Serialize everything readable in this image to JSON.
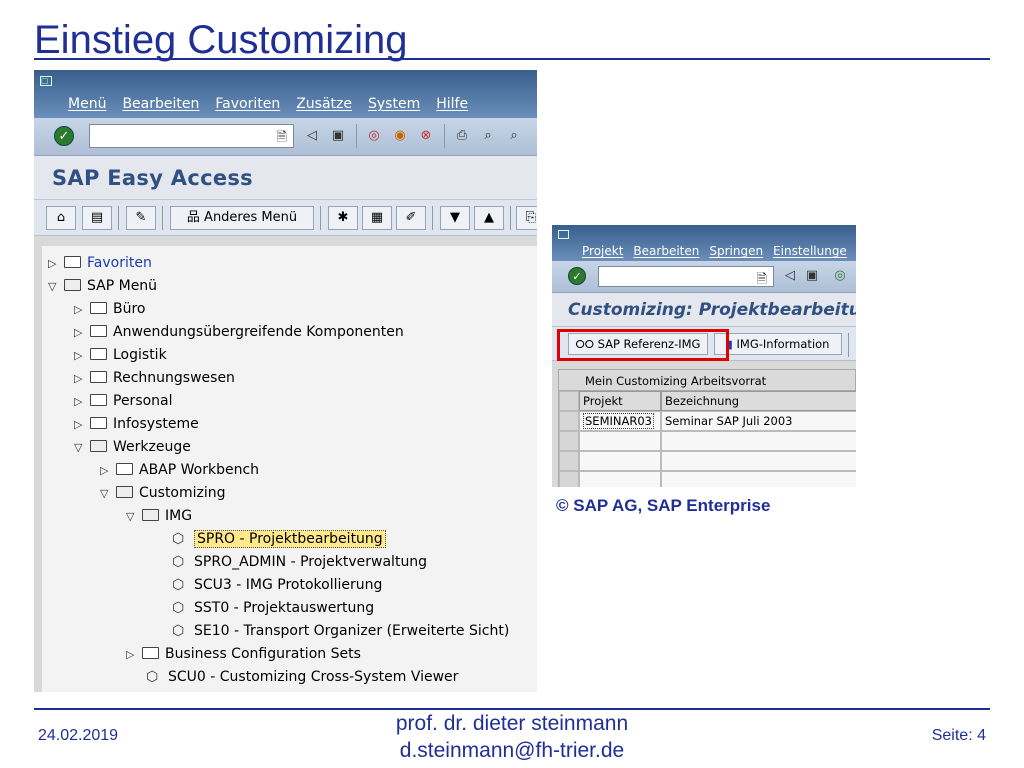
{
  "slide": {
    "title": "Einstieg Customizing",
    "copyright": "© SAP AG, SAP Enterprise",
    "footer": {
      "date": "24.02.2019",
      "author": "prof. dr. dieter steinmann",
      "email": "d.steinmann@fh-trier.de",
      "page": "Seite: 4"
    }
  },
  "window1": {
    "menu": [
      "Menü",
      "Bearbeiten",
      "Favoriten",
      "Zusätze",
      "System",
      "Hilfe"
    ],
    "title": "SAP Easy Access",
    "toolbar": {
      "other_menu": "Anderes Menü"
    },
    "tree": [
      {
        "label": "Favoriten",
        "kind": "folder",
        "open": false,
        "level": 0,
        "blue": true
      },
      {
        "label": "SAP Menü",
        "kind": "folder",
        "open": true,
        "level": 0
      },
      {
        "label": "Büro",
        "kind": "folder",
        "open": false,
        "level": 1
      },
      {
        "label": "Anwendungsübergreifende Komponenten",
        "kind": "folder",
        "open": false,
        "level": 1
      },
      {
        "label": "Logistik",
        "kind": "folder",
        "open": false,
        "level": 1
      },
      {
        "label": "Rechnungswesen",
        "kind": "folder",
        "open": false,
        "level": 1
      },
      {
        "label": "Personal",
        "kind": "folder",
        "open": false,
        "level": 1
      },
      {
        "label": "Infosysteme",
        "kind": "folder",
        "open": false,
        "level": 1
      },
      {
        "label": "Werkzeuge",
        "kind": "folder",
        "open": true,
        "level": 1
      },
      {
        "label": "ABAP Workbench",
        "kind": "folder",
        "open": false,
        "level": 2
      },
      {
        "label": "Customizing",
        "kind": "folder",
        "open": true,
        "level": 2
      },
      {
        "label": "IMG",
        "kind": "folder",
        "open": true,
        "level": 3
      },
      {
        "label": "SPRO - Projektbearbeitung",
        "kind": "tx",
        "level": 4,
        "highlight": true
      },
      {
        "label": "SPRO_ADMIN - Projektverwaltung",
        "kind": "tx",
        "level": 4
      },
      {
        "label": "SCU3 - IMG Protokollierung",
        "kind": "tx",
        "level": 4
      },
      {
        "label": "SST0 - Projektauswertung",
        "kind": "tx",
        "level": 4
      },
      {
        "label": "SE10 - Transport Organizer (Erweiterte Sicht)",
        "kind": "tx",
        "level": 4
      },
      {
        "label": "Business Configuration Sets",
        "kind": "folder",
        "open": false,
        "level": 3
      },
      {
        "label": "SCU0 - Customizing Cross-System Viewer",
        "kind": "tx",
        "level": 3
      }
    ]
  },
  "window2": {
    "menu": [
      "Projekt",
      "Bearbeiten",
      "Springen",
      "Einstellunge"
    ],
    "title": "Customizing: Projektbearbeitun",
    "toolbar": {
      "ref_img": "SAP Referenz-IMG",
      "img_info": "IMG-Information"
    },
    "grid_title": "Mein Customizing Arbeitsvorrat",
    "columns": [
      "Projekt",
      "Bezeichnung"
    ],
    "rows": [
      [
        "SEMINAR03",
        "Seminar SAP Juli 2003"
      ]
    ]
  }
}
